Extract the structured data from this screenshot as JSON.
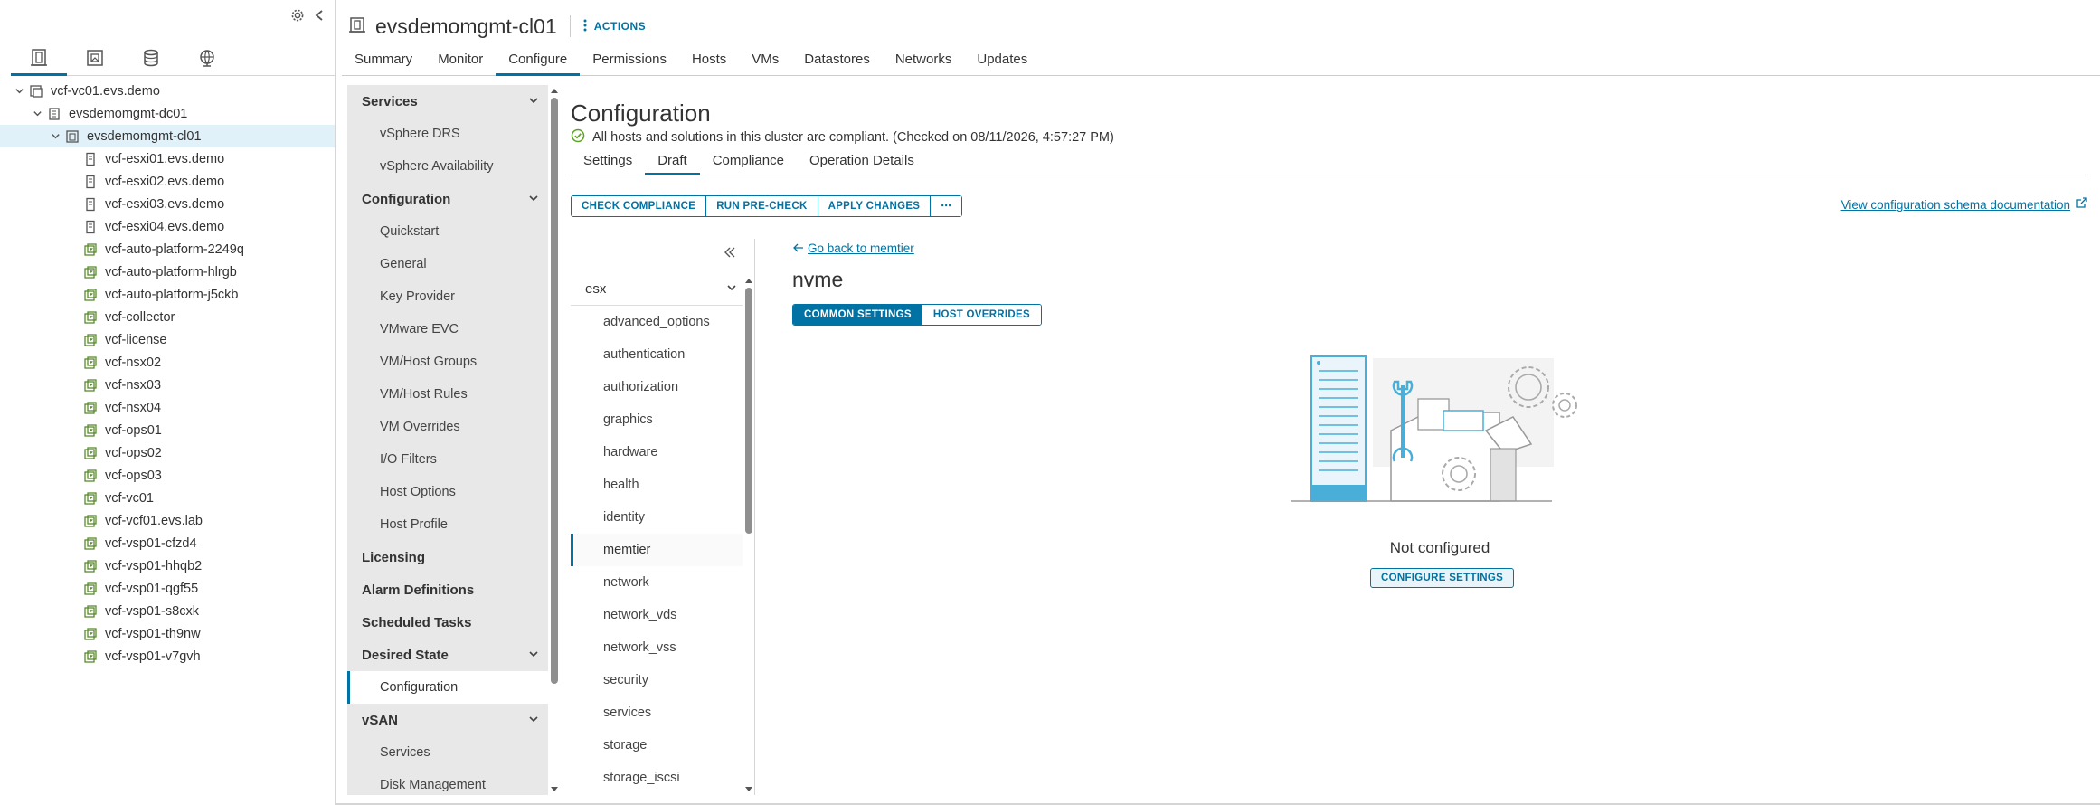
{
  "tree_panel": {
    "view_tabs": [
      {
        "icon": "hosts-clusters-icon",
        "active": true
      },
      {
        "icon": "vms-templates-icon",
        "active": false
      },
      {
        "icon": "storage-icon",
        "active": false
      },
      {
        "icon": "networking-icon",
        "active": false
      }
    ],
    "nodes": [
      {
        "label": "vcf-vc01.evs.demo",
        "level": 0,
        "icon": "vcenter-icon",
        "expanded": true
      },
      {
        "label": "evsdemomgmt-dc01",
        "level": 1,
        "icon": "datacenter-icon",
        "expanded": true
      },
      {
        "label": "evsdemomgmt-cl01",
        "level": 2,
        "icon": "cluster-icon",
        "expanded": true,
        "selected": true
      },
      {
        "label": "vcf-esxi01.evs.demo",
        "level": 3,
        "icon": "host-icon"
      },
      {
        "label": "vcf-esxi02.evs.demo",
        "level": 3,
        "icon": "host-icon"
      },
      {
        "label": "vcf-esxi03.evs.demo",
        "level": 3,
        "icon": "host-icon"
      },
      {
        "label": "vcf-esxi04.evs.demo",
        "level": 3,
        "icon": "host-icon"
      },
      {
        "label": "vcf-auto-platform-2249q",
        "level": 3,
        "icon": "vm-icon"
      },
      {
        "label": "vcf-auto-platform-hlrgb",
        "level": 3,
        "icon": "vm-icon"
      },
      {
        "label": "vcf-auto-platform-j5ckb",
        "level": 3,
        "icon": "vm-icon"
      },
      {
        "label": "vcf-collector",
        "level": 3,
        "icon": "vm-icon"
      },
      {
        "label": "vcf-license",
        "level": 3,
        "icon": "vm-icon"
      },
      {
        "label": "vcf-nsx02",
        "level": 3,
        "icon": "vm-icon"
      },
      {
        "label": "vcf-nsx03",
        "level": 3,
        "icon": "vm-icon"
      },
      {
        "label": "vcf-nsx04",
        "level": 3,
        "icon": "vm-icon"
      },
      {
        "label": "vcf-ops01",
        "level": 3,
        "icon": "vm-icon"
      },
      {
        "label": "vcf-ops02",
        "level": 3,
        "icon": "vm-icon"
      },
      {
        "label": "vcf-ops03",
        "level": 3,
        "icon": "vm-icon"
      },
      {
        "label": "vcf-vc01",
        "level": 3,
        "icon": "vm-icon"
      },
      {
        "label": "vcf-vcf01.evs.lab",
        "level": 3,
        "icon": "vm-icon"
      },
      {
        "label": "vcf-vsp01-cfzd4",
        "level": 3,
        "icon": "vm-icon"
      },
      {
        "label": "vcf-vsp01-hhqb2",
        "level": 3,
        "icon": "vm-icon"
      },
      {
        "label": "vcf-vsp01-qgf55",
        "level": 3,
        "icon": "vm-icon"
      },
      {
        "label": "vcf-vsp01-s8cxk",
        "level": 3,
        "icon": "vm-icon"
      },
      {
        "label": "vcf-vsp01-th9nw",
        "level": 3,
        "icon": "vm-icon"
      },
      {
        "label": "vcf-vsp01-v7gvh",
        "level": 3,
        "icon": "vm-icon"
      }
    ]
  },
  "header": {
    "title": "evsdemomgmt-cl01",
    "actions_label": "ACTIONS"
  },
  "main_tabs": [
    {
      "label": "Summary",
      "active": false
    },
    {
      "label": "Monitor",
      "active": false
    },
    {
      "label": "Configure",
      "active": true
    },
    {
      "label": "Permissions",
      "active": false
    },
    {
      "label": "Hosts",
      "active": false
    },
    {
      "label": "VMs",
      "active": false
    },
    {
      "label": "Datastores",
      "active": false
    },
    {
      "label": "Networks",
      "active": false
    },
    {
      "label": "Updates",
      "active": false
    }
  ],
  "settings_nav": [
    {
      "type": "group",
      "label": "Services",
      "collapsible": true
    },
    {
      "type": "item",
      "label": "vSphere DRS"
    },
    {
      "type": "item",
      "label": "vSphere Availability"
    },
    {
      "type": "group",
      "label": "Configuration",
      "collapsible": true
    },
    {
      "type": "item",
      "label": "Quickstart"
    },
    {
      "type": "item",
      "label": "General"
    },
    {
      "type": "item",
      "label": "Key Provider"
    },
    {
      "type": "item",
      "label": "VMware EVC"
    },
    {
      "type": "item",
      "label": "VM/Host Groups"
    },
    {
      "type": "item",
      "label": "VM/Host Rules"
    },
    {
      "type": "item",
      "label": "VM Overrides"
    },
    {
      "type": "item",
      "label": "I/O Filters"
    },
    {
      "type": "item",
      "label": "Host Options"
    },
    {
      "type": "item",
      "label": "Host Profile"
    },
    {
      "type": "group",
      "label": "Licensing",
      "collapsible": false
    },
    {
      "type": "group",
      "label": "Alarm Definitions",
      "collapsible": false
    },
    {
      "type": "group",
      "label": "Scheduled Tasks",
      "collapsible": false
    },
    {
      "type": "group",
      "label": "Desired State",
      "collapsible": true
    },
    {
      "type": "item",
      "label": "Configuration",
      "active": true
    },
    {
      "type": "group",
      "label": "vSAN",
      "collapsible": true
    },
    {
      "type": "item",
      "label": "Services"
    },
    {
      "type": "item",
      "label": "Disk Management"
    }
  ],
  "content": {
    "title": "Configuration",
    "compliance_text": "All hosts and solutions in this cluster are compliant. (Checked on 08/11/2026, 4:57:27 PM)",
    "sub_tabs": [
      {
        "label": "Settings",
        "active": false
      },
      {
        "label": "Draft",
        "active": true
      },
      {
        "label": "Compliance",
        "active": false
      },
      {
        "label": "Operation Details",
        "active": false
      }
    ],
    "actions": [
      "CHECK COMPLIANCE",
      "RUN PRE-CHECK",
      "APPLY CHANGES",
      "⋯"
    ],
    "schema_link": "View configuration schema documentation"
  },
  "sections": {
    "group_label": "esx",
    "items": [
      {
        "label": "advanced_options"
      },
      {
        "label": "authentication"
      },
      {
        "label": "authorization"
      },
      {
        "label": "graphics"
      },
      {
        "label": "hardware"
      },
      {
        "label": "health"
      },
      {
        "label": "identity"
      },
      {
        "label": "memtier",
        "active": true
      },
      {
        "label": "network"
      },
      {
        "label": "network_vds"
      },
      {
        "label": "network_vss"
      },
      {
        "label": "security"
      },
      {
        "label": "services"
      },
      {
        "label": "storage"
      },
      {
        "label": "storage_iscsi"
      }
    ]
  },
  "detail": {
    "back_link": "Go back to memtier",
    "title": "nvme",
    "segments": [
      {
        "label": "COMMON SETTINGS",
        "active": true
      },
      {
        "label": "HOST OVERRIDES",
        "active": false
      }
    ],
    "empty_state_text": "Not configured",
    "configure_button": "CONFIGURE SETTINGS"
  },
  "colors": {
    "accent": "#0072a3",
    "success": "#5aa220",
    "vm_icon": "#5a8a2e",
    "illustration_blue": "#49afd9"
  }
}
